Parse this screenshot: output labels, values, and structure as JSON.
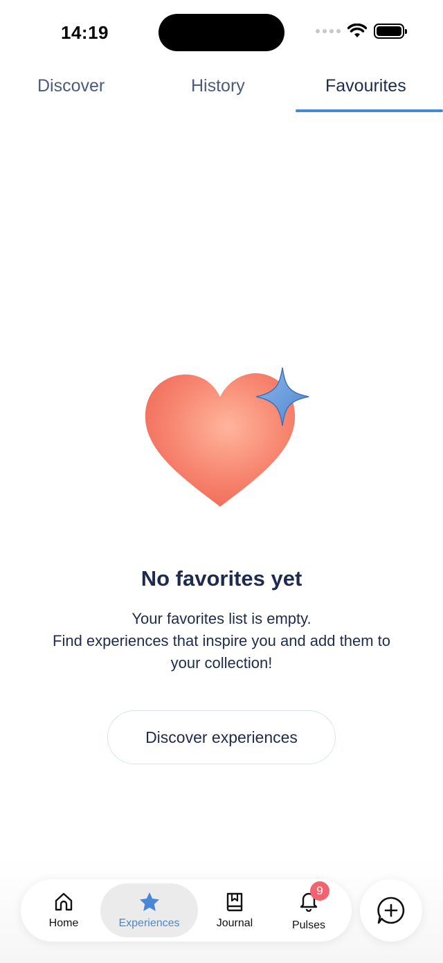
{
  "status_bar": {
    "time": "14:19",
    "icons": [
      "signal-icon",
      "wifi-icon",
      "battery-icon"
    ]
  },
  "tabs": [
    {
      "label": "Discover",
      "active": false
    },
    {
      "label": "History",
      "active": false
    },
    {
      "label": "Favourites",
      "active": true
    }
  ],
  "empty_state": {
    "illustration": "heart-with-sparkle-icon",
    "title": "No favorites yet",
    "text_line1": "Your favorites list is empty.",
    "text_line2": "Find experiences that inspire you and add them to",
    "text_line3": "your collection!",
    "button_label": "Discover experiences"
  },
  "bottom_nav": {
    "items": [
      {
        "label": "Home",
        "icon": "home-icon",
        "active": false
      },
      {
        "label": "Experiences",
        "icon": "star-icon",
        "active": true
      },
      {
        "label": "Journal",
        "icon": "journal-icon",
        "active": false
      },
      {
        "label": "Pulses",
        "icon": "bell-icon",
        "active": false,
        "badge": "9"
      }
    ],
    "chat_icon": "chat-add-icon"
  },
  "colors": {
    "accent": "#4a86d6",
    "text": "#1e2b4f",
    "badge": "#f1646f",
    "heart": "#f47c6a"
  }
}
